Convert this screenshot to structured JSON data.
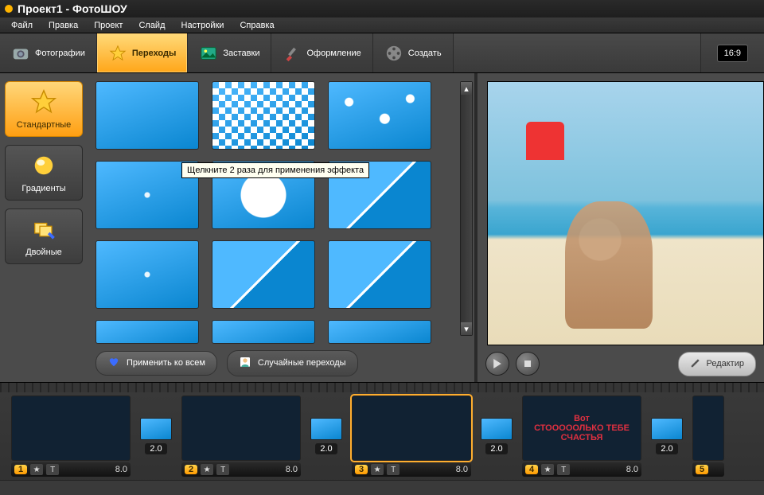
{
  "window": {
    "title": "Проект1 - ФотоШОУ"
  },
  "menu": {
    "items": [
      "Файл",
      "Правка",
      "Проект",
      "Слайд",
      "Настройки",
      "Справка"
    ]
  },
  "tabs": {
    "photos": "Фотографии",
    "transitions": "Переходы",
    "screensavers": "Заставки",
    "design": "Оформление",
    "create": "Создать"
  },
  "aspect_ratio": "16:9",
  "categories": {
    "standard": "Стандартные",
    "gradients": "Градиенты",
    "double": "Двойные"
  },
  "tooltip": "Щелкните 2 раза для применения эффекта",
  "buttons": {
    "apply_all": "Применить ко всем",
    "random_transitions": "Случайные переходы",
    "edit_slide": "Редактир"
  },
  "chart_data": null,
  "timeline": {
    "slides": [
      {
        "index": "1",
        "duration": "8.0"
      },
      {
        "index": "2",
        "duration": "8.0"
      },
      {
        "index": "3",
        "duration": "8.0"
      },
      {
        "index": "4",
        "duration": "8.0"
      },
      {
        "index": "5",
        "duration": ""
      }
    ],
    "transitions": [
      {
        "duration": "2.0"
      },
      {
        "duration": "2.0"
      },
      {
        "duration": "2.0"
      },
      {
        "duration": "2.0"
      }
    ],
    "selected_index": 2,
    "audio_track": "gitara_skripka_pianino_i_bit_muzyka_dlya_dushi_-_bez_slov_(iPlayer.fm).mp3"
  },
  "slide4_text": {
    "l1": "Вот",
    "l2": "СТОООООЛЬКО ТЕБЕ",
    "l3": "СЧАСТЬЯ"
  }
}
